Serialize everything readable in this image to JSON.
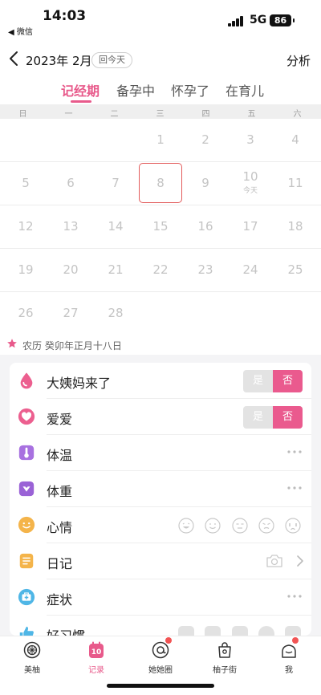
{
  "status": {
    "time": "14:03",
    "back_app": "◀ 微信",
    "network": "5G",
    "battery": "86"
  },
  "header": {
    "month": "2023年 2月",
    "today_button": "回今天",
    "analysis": "分析"
  },
  "tabs": [
    {
      "label": "记经期",
      "active": true
    },
    {
      "label": "备孕中",
      "active": false
    },
    {
      "label": "怀孕了",
      "active": false
    },
    {
      "label": "在育儿",
      "active": false
    }
  ],
  "weekdays": [
    "日",
    "一",
    "二",
    "三",
    "四",
    "五",
    "六"
  ],
  "calendar": {
    "days": [
      "1",
      "2",
      "3",
      "4",
      "5",
      "6",
      "7",
      "8",
      "9",
      "10",
      "11",
      "12",
      "13",
      "14",
      "15",
      "16",
      "17",
      "18",
      "19",
      "20",
      "21",
      "22",
      "23",
      "24",
      "25",
      "26",
      "27",
      "28"
    ],
    "selected": "8",
    "today": "10",
    "today_label": "今天"
  },
  "lunar": "农历 癸卯年正月十八日",
  "records": [
    {
      "label": "大姨妈来了",
      "control": "toggle",
      "yes": "是",
      "no": "否",
      "icon": "drop-icon",
      "color": "#ec5f8f"
    },
    {
      "label": "爱爱",
      "control": "toggle",
      "yes": "是",
      "no": "否",
      "icon": "heart-icon",
      "color": "#ec5f8f"
    },
    {
      "label": "体温",
      "control": "more",
      "icon": "thermometer-icon",
      "color": "#a871e0"
    },
    {
      "label": "体重",
      "control": "more",
      "icon": "scale-icon",
      "color": "#9a62d6"
    },
    {
      "label": "心情",
      "control": "moods",
      "icon": "smile-icon",
      "color": "#f4b44a"
    },
    {
      "label": "日记",
      "control": "diary",
      "icon": "diary-icon",
      "color": "#f4b44a"
    },
    {
      "label": "症状",
      "control": "more",
      "icon": "medkit-icon",
      "color": "#4fb6e6"
    },
    {
      "label": "好习惯",
      "control": "habits",
      "icon": "thumb-icon",
      "color": "#4fb6e6"
    }
  ],
  "tabbar": [
    {
      "label": "美柚",
      "icon": "meiyou-icon",
      "active": false,
      "badge": false
    },
    {
      "label": "记录",
      "icon": "calendar-10-icon",
      "active": true,
      "badge": false,
      "icon_text": "10"
    },
    {
      "label": "她她圈",
      "icon": "circle-at-icon",
      "active": false,
      "badge": true
    },
    {
      "label": "柚子街",
      "icon": "shopping-bag-icon",
      "active": false,
      "badge": false
    },
    {
      "label": "我",
      "icon": "profile-icon",
      "active": false,
      "badge": true
    }
  ],
  "colors": {
    "accent": "#e85a8b",
    "selected_border": "#e25b5b",
    "badge": "#f25454"
  }
}
